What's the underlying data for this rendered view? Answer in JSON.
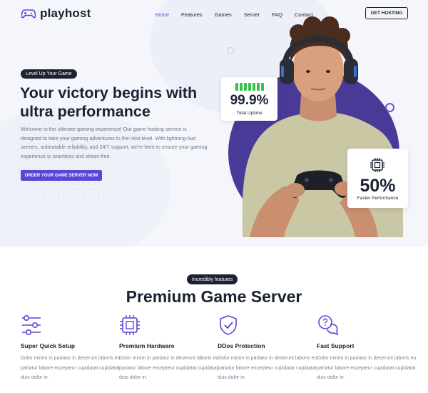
{
  "header": {
    "brand": "playhost",
    "nav": [
      {
        "label": "Home",
        "active": true
      },
      {
        "label": "Features",
        "active": false
      },
      {
        "label": "Games",
        "active": false
      },
      {
        "label": "Server",
        "active": false
      },
      {
        "label": "FAQ",
        "active": false
      },
      {
        "label": "Contact",
        "active": false
      }
    ],
    "cta": "GET HOSTING"
  },
  "hero": {
    "badge": "Level Up Your Game",
    "title_line1": "Your victory begins with",
    "title_line2": "ultra performance",
    "description": "Welcome to the ultimate gaming experience! Our game hosting service is designed to take your gaming adventures to the next level. With lightning-fast servers, unbeatable reliability, and 24/7 support, we're here to ensure your gaming experience is seamless and stress-free.",
    "button": "ORDER YOUR GAME SERVER NOW"
  },
  "stats": {
    "uptime_value": "99.9%",
    "uptime_label": "Total Uptime",
    "performance_value": "50%",
    "performance_label": "Faster Performance"
  },
  "features": {
    "badge": "Incredibly features",
    "title": "Premium Game Server",
    "items": [
      {
        "icon": "sliders-icon",
        "title": "Super Quick Setup",
        "text": "Dolor minim in pariatur in deserunt laboris eu pariatur labore excepteur cupidatat cupidatat duis dolor in."
      },
      {
        "icon": "cpu-chip-icon",
        "title": "Premium Hardware",
        "text": "Dolor minim in pariatur in deserunt laboris eu pariatur labore excepteur cupidatat cupidatat duis dolor in."
      },
      {
        "icon": "shield-check-icon",
        "title": "DDos Protection",
        "text": "Dolor minim in pariatur in deserunt laboris eu pariatur labore excepteur cupidatat cupidatat duis dolor in."
      },
      {
        "icon": "support-chat-icon",
        "title": "Fast Support",
        "text": "Dolor minim in pariatur in deserunt laboris eu pariatur labore excepteur cupidatat cupidatat duis dolor in."
      }
    ]
  },
  "colors": {
    "accent": "#5a46d6",
    "dark": "#1b2232",
    "uptime_green": "#35c24a",
    "circle_purple": "#4a3a98"
  }
}
